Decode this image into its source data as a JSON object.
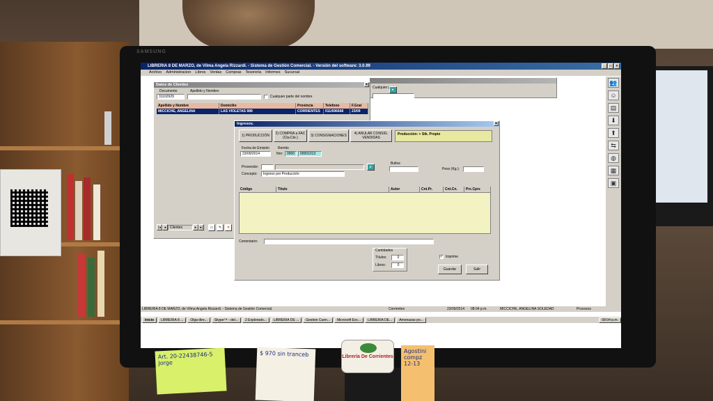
{
  "app": {
    "title": "LIBRERIA 8 DE MARZO, de Vilma Angela Rizzardi. - Sistema de Gestión Comercial. - Versión del software: 3.0.99",
    "menu": [
      "Archivo",
      "Administracion",
      "Libros",
      "Ventas",
      "Compras",
      "Tesoreria",
      "Informes",
      "Sucursal"
    ]
  },
  "clientes_window": {
    "title": "Datos de Clientes",
    "documento_label": "Documento",
    "documento_value": "31102929",
    "apellido_label": "Apellido y Nombre:",
    "apellido_value": "",
    "checkbox_label": "Cualquier parte del nombre",
    "columns": [
      "Apellido y Nombre",
      "Domicilio",
      "Provincia",
      "Telefono",
      "F.Grat"
    ],
    "row": [
      "MICCICHE, ANGELINA",
      "LAS VIOLETAS 989",
      "CORRIENTES",
      "011/696668",
      "23/09"
    ],
    "nav_label": "Clientes"
  },
  "bg_window": {
    "partial_label": "Cualquier parte"
  },
  "ingresos_window": {
    "title": "Ingresos.",
    "tabs": [
      "1) PRODUCCIÓN",
      "2) COMPRA a FAC (Cta.Cte.)",
      "3) CONSIGNACIONES",
      "4) ANULAR CONSIG. VENDIDAS"
    ],
    "info_box": "Producción: + Stk. Propio",
    "fecha_label": "Fecha de Emisión",
    "fecha_value": "23/09/2014",
    "remito_label": "Remito",
    "nro_label": "Nro:",
    "nro_prefix": "0000",
    "nro_value": "00001013",
    "proveedor_label": "Proveedor:",
    "concepto_label": "Concepto:",
    "concepto_value": "Ingreso por Producción",
    "bultos_label": "Bultos",
    "peso_label": "Peso (Kg.):",
    "columns": [
      "Código",
      "Título",
      "Autor",
      "Cnt.Pr.",
      "Cnt.Cn.",
      "Prc.Cprs"
    ],
    "comentario_label": "Comentario:",
    "cantidades_label": "Cantidades",
    "titulos_label": "Títulos:",
    "titulos_value": "0",
    "libros_label": "Libros:",
    "libros_value": "0",
    "imprime_label": "Imprime",
    "guardar_label": "Guardar",
    "salir_label": "Salir"
  },
  "statusbar": {
    "text": "LIBRERIA 8 DE MARZO, de Vilma Angela Rizzardi. - Sistema de Gestión Comercial.",
    "corrientes": "Corrientes",
    "date": "23/09/2014",
    "time": "08:04 p.m.",
    "user": "MICCICHE, ANGELINA SOLEDAD",
    "procesos": "Procesos"
  },
  "taskbar": {
    "start": "Inicio",
    "tasks": [
      "LIBRERIA 8 ...",
      "Olga dire...",
      "Skype™ - del...",
      "2 Explorado...",
      "LIBRERIA DE ...",
      "Gestion Cuen...",
      "Microsoft Exc...",
      "LIBRERIA DE...",
      "Amenazas po..."
    ],
    "clock": "08:04 p.m."
  },
  "notes": {
    "green": "Art. 20-22438746-5 Jorge",
    "white": "$ 970 sin tranceb",
    "orange": "Agostini compz 12-13"
  },
  "sticker": "Librería De Corrientes",
  "monitor_brand": "SAMSUNG"
}
